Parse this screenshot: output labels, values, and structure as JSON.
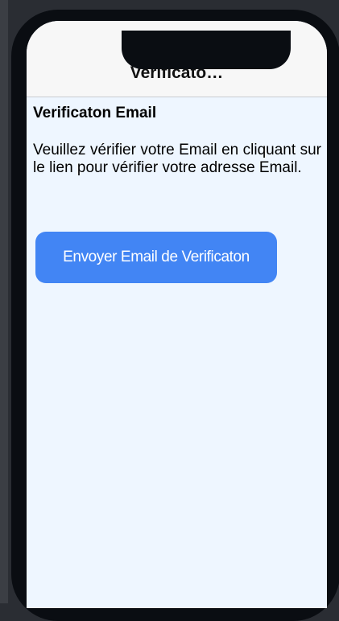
{
  "header": {
    "title": "Verificato…"
  },
  "main": {
    "heading": "Verificaton Email",
    "message": "Veuillez vérifier votre Email en cliquant sur le lien pour vérifier votre adresse Email.",
    "send_button_label": "Envoyer Email de Verificaton"
  },
  "colors": {
    "screen_background": "#eef6ff",
    "nav_background": "#f7f7f7",
    "button": "#4285f4",
    "device_frame": "#0a0d12"
  }
}
